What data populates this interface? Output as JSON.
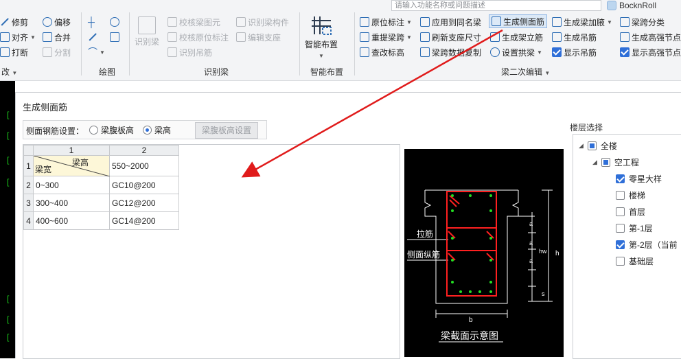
{
  "topbar": {
    "search_placeholder": "请输入功能名称或问题描述",
    "username": "BocknRoll"
  },
  "ribbon": {
    "edit": {
      "trim": "修剪",
      "offset": "偏移",
      "align": "对齐",
      "merge": "合并",
      "break": "打断",
      "split": "分割",
      "group_label": "改"
    },
    "draw": {
      "group_label": "绘图"
    },
    "identify": {
      "identify_beam": "识别梁",
      "check_beam": "校核梁图元",
      "check_origin": "校核原位标注",
      "identify_hanger": "识别吊筋",
      "identify_member": "识别梁构件",
      "edit_support": "编辑支座",
      "group_label": "识别梁"
    },
    "smart": {
      "smart_layout": "智能布置",
      "group_label": "智能布置"
    },
    "secondary": {
      "origin_mark": "原位标注",
      "apply_same": "应用到同名梁",
      "gen_side_bar": "生成侧面筋",
      "gen_haunch": "生成梁加腋",
      "span_class": "梁跨分类",
      "reextract_span": "重提梁跨",
      "refresh_support": "刷新支座尺寸",
      "gen_erect_bar": "生成架立筋",
      "gen_hanger": "生成吊筋",
      "gen_strengthen": "生成高强节点",
      "check_elev": "查改标高",
      "copy_span_data": "梁跨数据复制",
      "set_arch": "设置拱梁",
      "show_hanger": "显示吊筋",
      "show_strengthen": "显示高强节点",
      "group_label": "梁二次编辑"
    }
  },
  "dialog": {
    "title": "生成侧面筋",
    "setting_label": "侧面钢筋设置：",
    "radio_web": "梁腹板高",
    "radio_height": "梁高",
    "web_setting_button": "梁腹板高设置",
    "table": {
      "col_headers": [
        "1",
        "2"
      ],
      "corner_top": "梁高",
      "corner_bottom": "梁宽",
      "header_value": "550~2000",
      "rows": [
        {
          "num": "2",
          "width": "0~300",
          "bar": "GC10@200"
        },
        {
          "num": "3",
          "width": "300~400",
          "bar": "GC12@200"
        },
        {
          "num": "4",
          "width": "400~600",
          "bar": "GC14@200"
        }
      ],
      "first_row_num": "1"
    },
    "diagram": {
      "tie_label": "拉筋",
      "side_label": "侧面纵筋",
      "caption": "梁截面示意图",
      "dim_a": "a",
      "dim_hw": "hw",
      "dim_h": "h",
      "dim_s": "s",
      "dim_b": "b"
    },
    "floor": {
      "title": "楼层选择",
      "items": [
        {
          "label": "全楼",
          "state": "partial"
        },
        {
          "label": "空工程",
          "state": "partial"
        },
        {
          "label": "零星大样",
          "state": "checked"
        },
        {
          "label": "楼梯",
          "state": "unchecked"
        },
        {
          "label": "首层",
          "state": "unchecked"
        },
        {
          "label": "第-1层",
          "state": "unchecked"
        },
        {
          "label": "第-2层（当前",
          "state": "checked"
        },
        {
          "label": "基础层",
          "state": "unchecked"
        }
      ]
    }
  },
  "colors": {
    "accent": "#2f6fd8",
    "arrow": "#e01b1b",
    "rebar": "#ff2020",
    "stirrup_dot": "#22dd22"
  }
}
